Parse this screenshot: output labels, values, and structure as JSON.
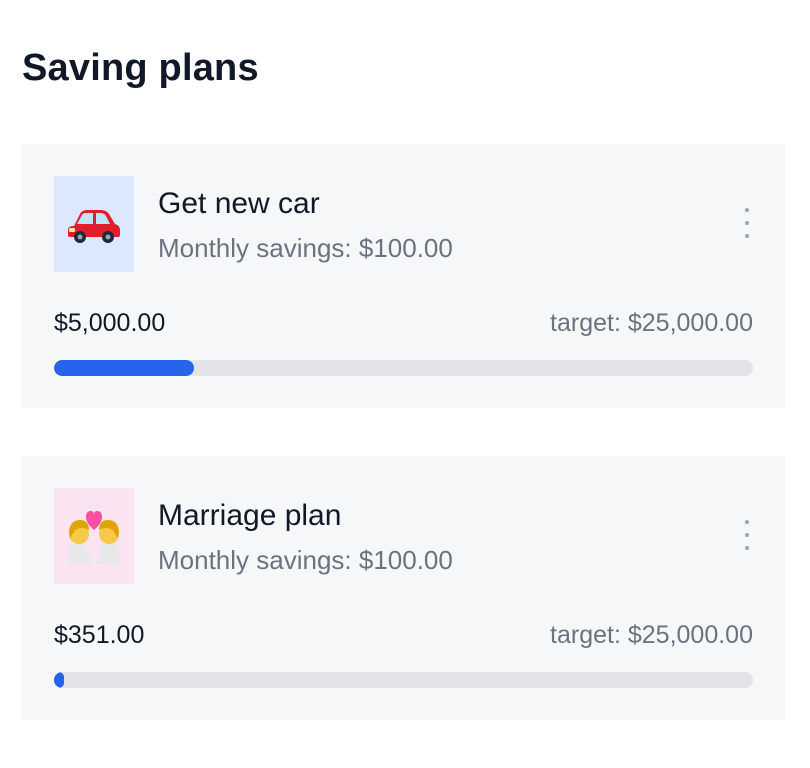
{
  "header": {
    "title": "Saving plans"
  },
  "plans": [
    {
      "name": "Get new car",
      "monthly": "Monthly savings: $100.00",
      "saved": "$5,000.00",
      "target": "target: $25,000.00",
      "progress": 0.2,
      "icon": "car-icon",
      "icon_bg": "#dbe8fd"
    },
    {
      "name": "Marriage plan",
      "monthly": "Monthly savings: $100.00",
      "saved": "$351.00",
      "target": "target: $25,000.00",
      "progress": 0.014,
      "icon": "couple-kiss-icon",
      "icon_bg": "#fbe4f1"
    }
  ],
  "colors": {
    "progress_fill": "#2563eb",
    "progress_track": "#e2e4e9",
    "card_bg": "#f6f7f9"
  }
}
